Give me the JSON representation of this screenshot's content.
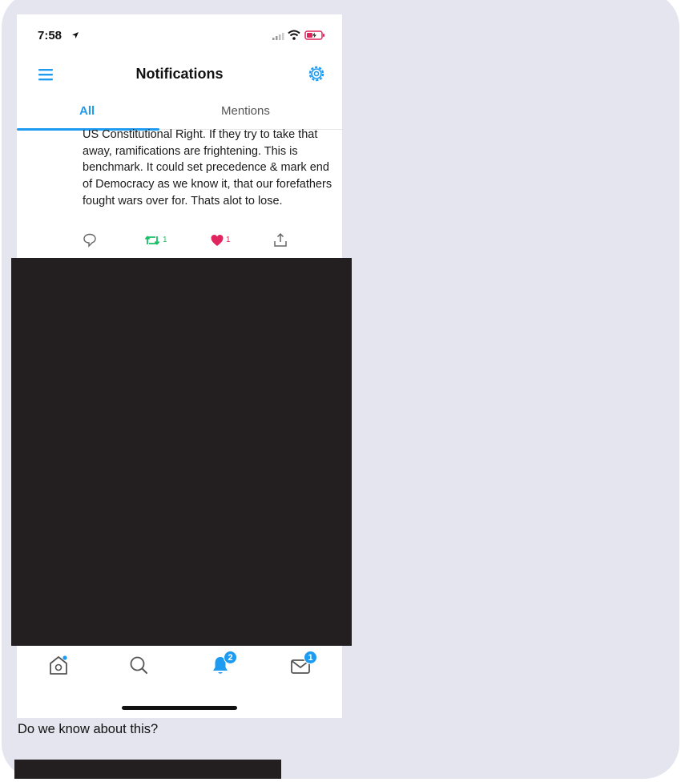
{
  "status_bar": {
    "time": "7:58"
  },
  "header": {
    "title": "Notifications"
  },
  "tabs": [
    {
      "label": "All",
      "active": true
    },
    {
      "label": "Mentions",
      "active": false
    }
  ],
  "tweet": {
    "text": "US Constitutional Right. If they try to take that away, ramifications are frightening. This is benchmark. It could set precedence & mark end of Democracy as we know it, that our forefathers fought wars over for. Thats alot to lose.",
    "retweets": "1",
    "likes": "1"
  },
  "bottom_nav": {
    "notifications_badge": "2",
    "messages_badge": "1"
  },
  "caption": "Do we know about this?",
  "colors": {
    "accent": "#1d9bf0",
    "retweet": "#17bf63",
    "like": "#e0245e",
    "redaction": "#231f20",
    "background": "#e4e5ee"
  },
  "icons": [
    "location-arrow-icon",
    "signal-icon",
    "wifi-icon",
    "battery-icon",
    "menu-icon",
    "gear-icon",
    "reply-icon",
    "retweet-icon",
    "like-icon",
    "share-icon",
    "home-icon",
    "search-icon",
    "bell-icon",
    "mail-icon"
  ]
}
